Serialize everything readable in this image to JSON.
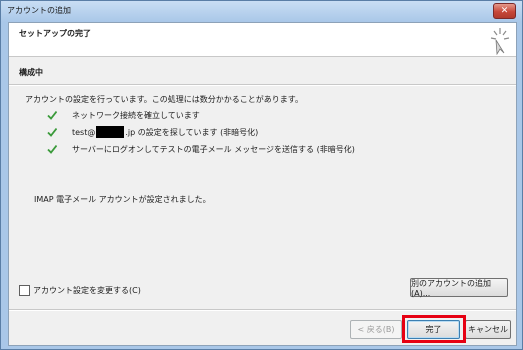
{
  "window": {
    "title": "アカウントの追加",
    "close_label": "✕"
  },
  "header": {
    "title": "セットアップの完了",
    "icon": "wizard-sparkle-icon"
  },
  "section": {
    "title": "構成中",
    "description": "アカウントの設定を行っています。この処理には数分かかることがあります。"
  },
  "tasks": [
    {
      "status": "done",
      "icon": "check-icon",
      "text": "ネットワーク接続を確立しています"
    },
    {
      "status": "done",
      "icon": "check-icon",
      "prefix": "test@",
      "suffix": ".jp の設定を探しています (非暗号化)"
    },
    {
      "status": "done",
      "icon": "check-icon",
      "text": "サーバーにログオンしてテストの電子メール メッセージを送信する (非暗号化)"
    }
  ],
  "result_message": "IMAP 電子メール アカウントが設定されました。",
  "change_settings_checkbox": {
    "label": "アカウント設定を変更する(C)",
    "checked": false
  },
  "buttons": {
    "add_another": "別のアカウントの追加(A)...",
    "back": "< 戻る(B)",
    "finish": "完了",
    "cancel": "キャンセル"
  },
  "colors": {
    "check": "#3a9a3a",
    "highlight": "#e60012",
    "titlebar": "#a9c7e8"
  }
}
